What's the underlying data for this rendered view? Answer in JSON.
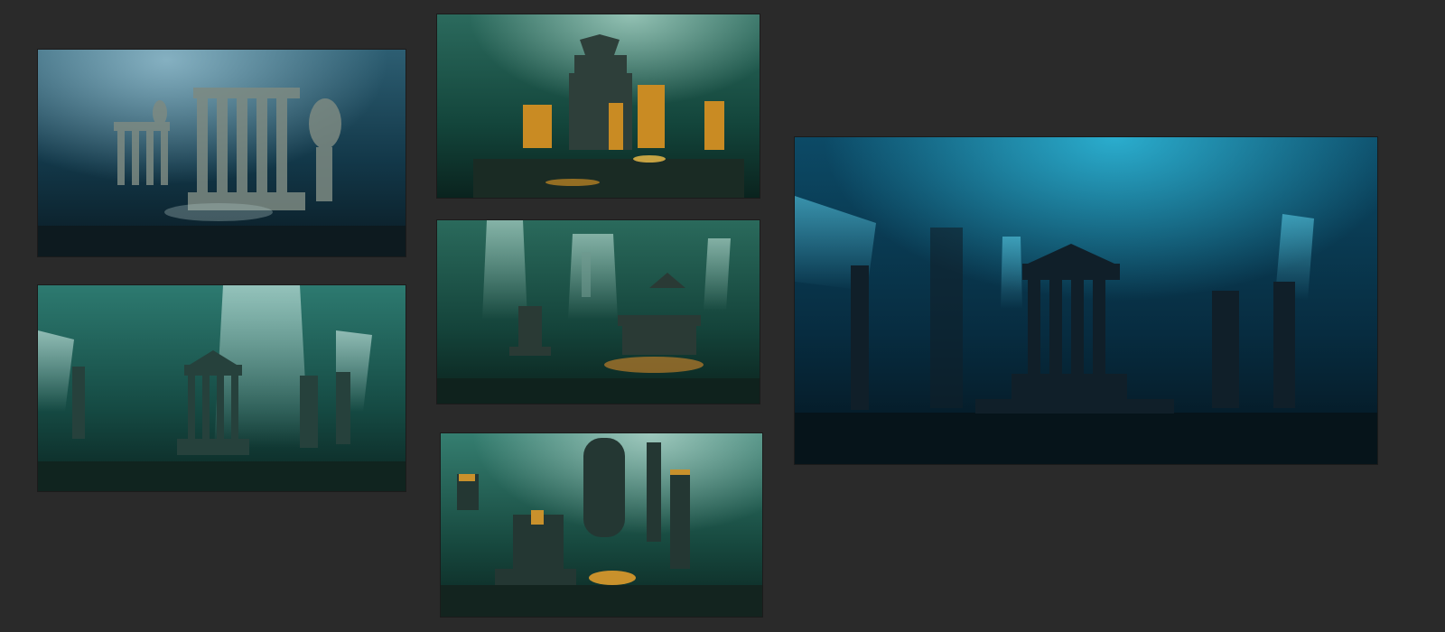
{
  "gallery": {
    "background": "#2a2a2a",
    "images": [
      {
        "name": "underwater-greek-temple-statues",
        "palette": [
          "#0b2f3f",
          "#2f6f7f",
          "#b8c8b0"
        ]
      },
      {
        "name": "underwater-pagoda-golden-lights",
        "palette": [
          "#0d3b33",
          "#2c6e5e",
          "#e0a02a"
        ]
      },
      {
        "name": "underwater-temple-ruins-spotlights",
        "palette": [
          "#0d3b38",
          "#2f7f75",
          "#d8f0ea"
        ]
      },
      {
        "name": "underwater-ruined-city-pillars",
        "palette": [
          "#0e3a33",
          "#2b6a5c",
          "#c8822a"
        ]
      },
      {
        "name": "underwater-carved-towers-gold",
        "palette": [
          "#0f3d36",
          "#3b8a7c",
          "#d9a23a"
        ]
      },
      {
        "name": "underwater-blue-temple-large",
        "palette": [
          "#041d2c",
          "#0b6a8a",
          "#5fd4ee"
        ]
      }
    ]
  }
}
